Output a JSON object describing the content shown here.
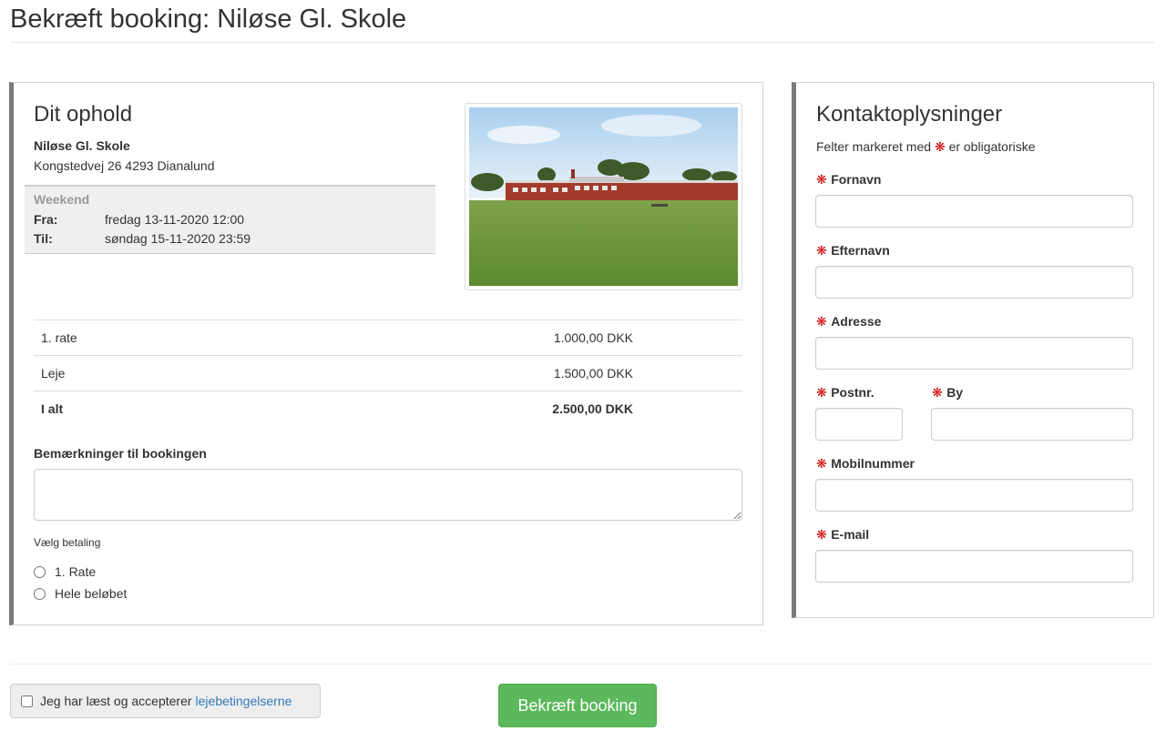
{
  "page": {
    "title": "Bekræft booking: Niløse Gl. Skole"
  },
  "stay": {
    "heading": "Dit ophold",
    "venue_name": "Niløse Gl. Skole",
    "venue_address": "Kongstedvej 26 4293 Dianalund",
    "period_type": "Weekend",
    "from_label": "Fra:",
    "from_value": "fredag 13-11-2020 12:00",
    "to_label": "Til:",
    "to_value": "søndag 15-11-2020 23:59",
    "photo_icon": "school-building-photo"
  },
  "prices": [
    {
      "label": "1. rate",
      "value": "1.000,00 DKK"
    },
    {
      "label": "Leje",
      "value": "1.500,00 DKK"
    },
    {
      "label": "I alt",
      "value": "2.500,00 DKK"
    }
  ],
  "remarks": {
    "label": "Bemærkninger til bookingen",
    "value": ""
  },
  "payment": {
    "label": "Vælg betaling",
    "options": [
      "1. Rate",
      "Hele beløbet"
    ]
  },
  "contact": {
    "heading": "Kontaktoplysninger",
    "note_prefix": "Felter markeret med",
    "note_suffix": "er obligatoriske",
    "star": "❋",
    "fields": {
      "firstname": {
        "label": "Fornavn",
        "value": ""
      },
      "lastname": {
        "label": "Efternavn",
        "value": ""
      },
      "address": {
        "label": "Adresse",
        "value": ""
      },
      "zip": {
        "label": "Postnr.",
        "value": ""
      },
      "city": {
        "label": "By",
        "value": ""
      },
      "mobile": {
        "label": "Mobilnummer",
        "value": ""
      },
      "email": {
        "label": "E-mail",
        "value": ""
      }
    }
  },
  "footer": {
    "terms_text": "Jeg har læst og accepterer",
    "terms_link": "lejebetingelserne",
    "confirm_label": "Bekræft booking"
  },
  "colors": {
    "accent_green": "#5cb85c",
    "required_red": "#cc0000",
    "link_blue": "#337ab7",
    "panel_border_left": "#7a7a7a"
  }
}
